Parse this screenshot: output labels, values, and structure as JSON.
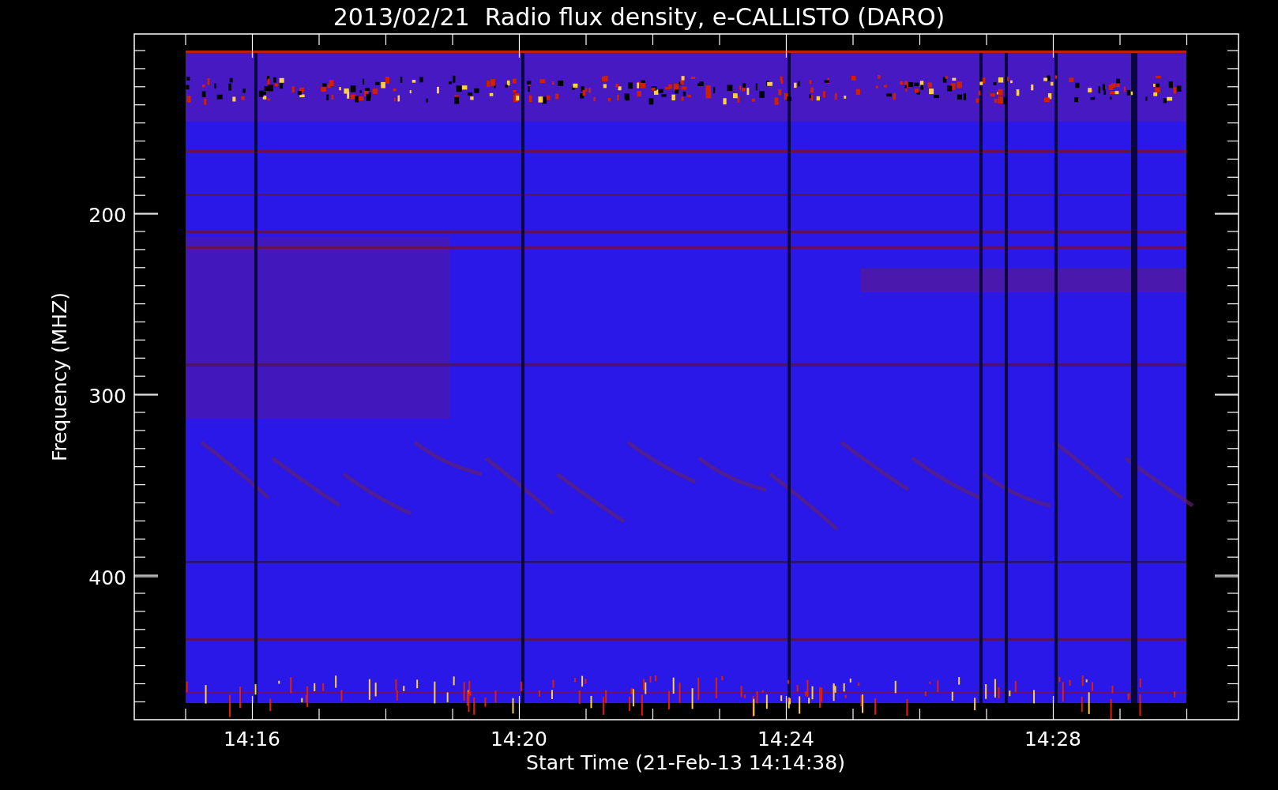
{
  "title": "2013/02/21  Radio flux density, e-CALLISTO (DARO)",
  "y_axis": {
    "label": "Frequency (MHZ)",
    "ticks": [
      "200",
      "300",
      "400"
    ]
  },
  "x_axis": {
    "label": "Start Time (21-Feb-13 14:14:38)",
    "ticks": [
      "14:16",
      "14:20",
      "14:24",
      "14:28"
    ]
  }
}
